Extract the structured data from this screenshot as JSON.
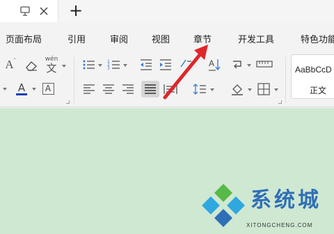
{
  "titlebar": {
    "icons": [
      "pin-icon",
      "close-icon",
      "new-tab-icon"
    ],
    "new_tab_glyph": "+"
  },
  "menu": {
    "items": [
      "页面布局",
      "引用",
      "审阅",
      "视图",
      "章节",
      "开发工具",
      "特色功能"
    ]
  },
  "toolbar": {
    "pinyin_label": "wén",
    "font_color_letter": "A",
    "font_color": "#1a3fb8",
    "char_border_letter": "A",
    "clear_letter": "A",
    "sort_label": "A↓"
  },
  "styles": {
    "preview_text": "AaBbCcD",
    "style_name": "正文"
  },
  "document": {
    "background": "#cfe8d2"
  },
  "watermark": {
    "brand_text": "系统城",
    "url_text": "XITONGCHENG.COM",
    "brand_color": "#2f6fb6",
    "logo_colors": [
      "#2fa8e0",
      "#57b947",
      "#2f6fb6"
    ]
  },
  "annotation": {
    "arrow_color": "#e0262b"
  }
}
